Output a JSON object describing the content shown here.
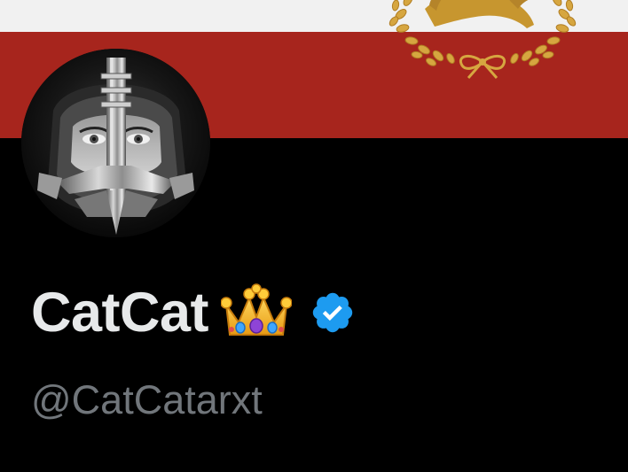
{
  "profile": {
    "display_name": "CatCat",
    "name_emoji": "crown-icon",
    "verified_badge": "verified-badge-icon",
    "handle": "@CatCatarxt"
  },
  "banner": {
    "stripe_colors": [
      "#f1f1f1",
      "#a7251d"
    ],
    "emblem": "lion-and-sun-emblem"
  },
  "colors": {
    "background": "#000000",
    "name_text": "#e7e9ea",
    "handle_text": "#71767b",
    "verified_blue": "#1d9bf0"
  }
}
